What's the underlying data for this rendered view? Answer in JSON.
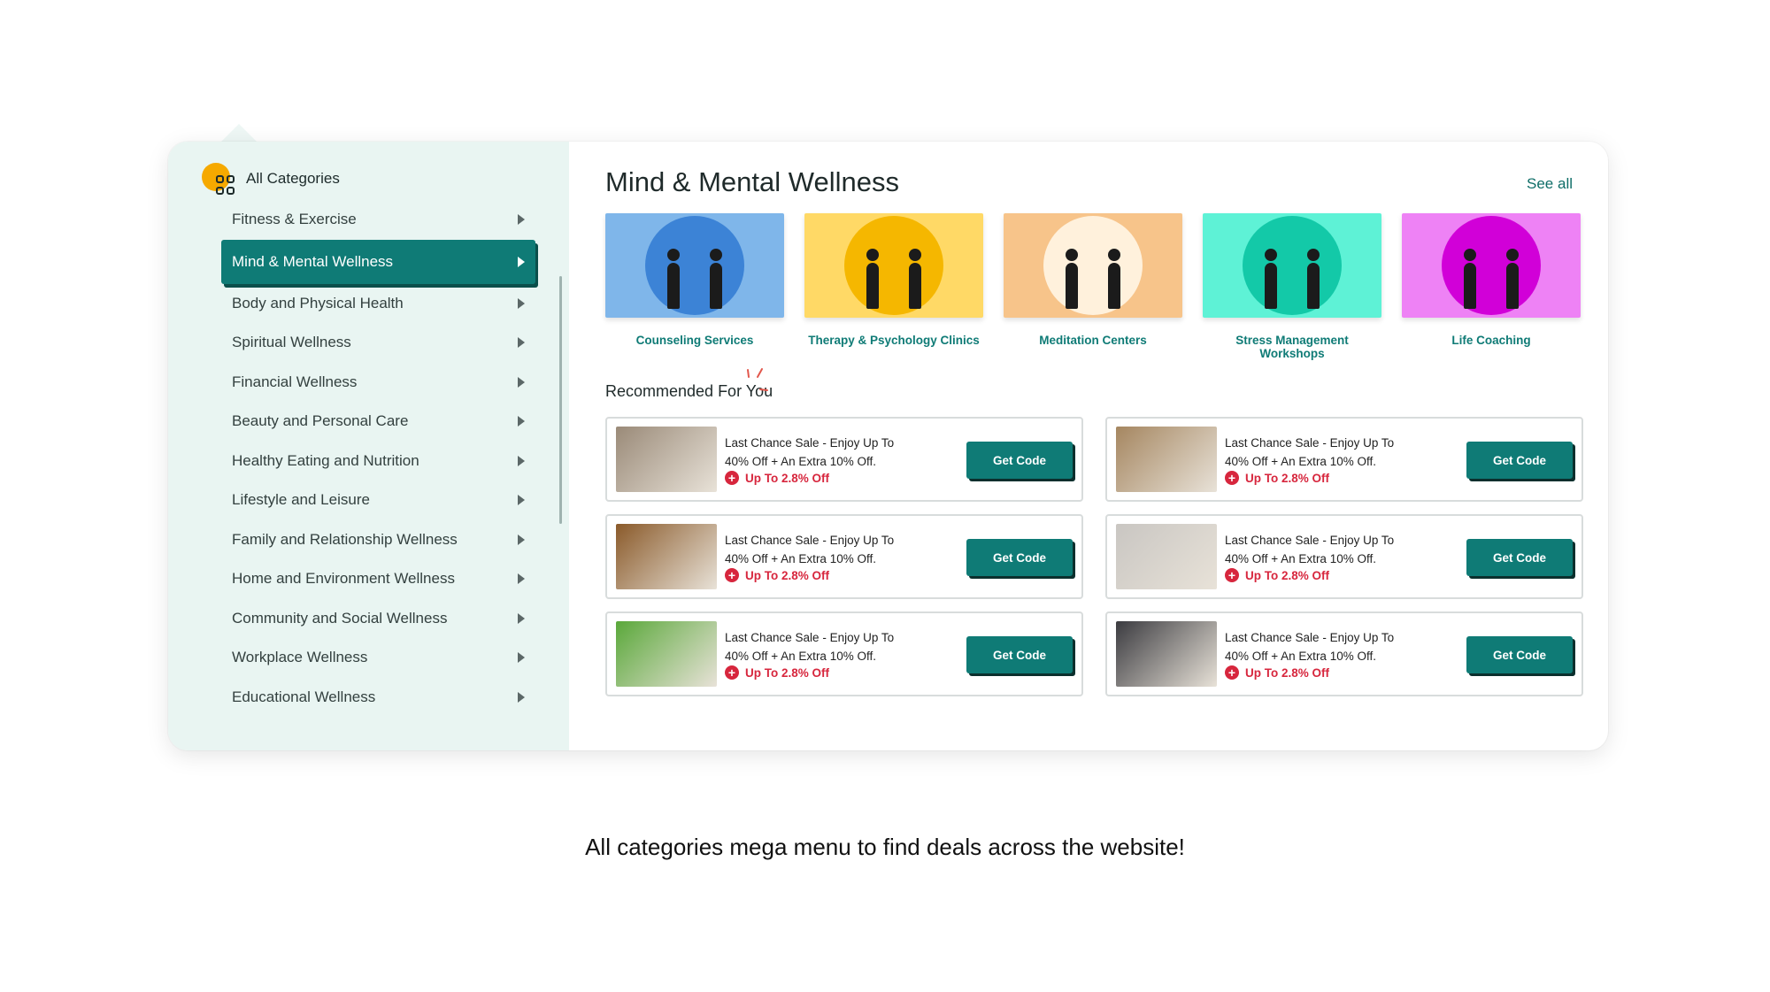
{
  "sidebar": {
    "all_categories_label": "All Categories",
    "items": [
      {
        "label": "Fitness & Exercise"
      },
      {
        "label": "Mind & Mental Wellness",
        "active": true
      },
      {
        "label": "Body and Physical Health"
      },
      {
        "label": "Spiritual Wellness"
      },
      {
        "label": "Financial Wellness"
      },
      {
        "label": "Beauty and Personal Care"
      },
      {
        "label": "Healthy Eating and Nutrition"
      },
      {
        "label": "Lifestyle and Leisure"
      },
      {
        "label": "Family and Relationship Wellness"
      },
      {
        "label": "Home and Environment Wellness"
      },
      {
        "label": "Community and Social Wellness"
      },
      {
        "label": "Workplace Wellness"
      },
      {
        "label": "Educational Wellness"
      }
    ]
  },
  "main": {
    "heading": "Mind & Mental Wellness",
    "see_all": "See all",
    "subcategories": [
      {
        "label": "Counseling Services",
        "bg": "#7fb6ea",
        "circle": "#3c83d6"
      },
      {
        "label": "Therapy & Psychology Clinics",
        "bg": "#ffd966",
        "circle": "#f5b700"
      },
      {
        "label": "Meditation Centers",
        "bg": "#f7c48a",
        "circle": "#fff1dc"
      },
      {
        "label": "Stress Management Workshops",
        "bg": "#5ef2d6",
        "circle": "#13c9a8"
      },
      {
        "label": "Life Coaching",
        "bg": "#ee82f5",
        "circle": "#d100d8"
      }
    ],
    "recommended_title": "Recommended For You",
    "deals": [
      {
        "title": "Last Chance Sale - Enjoy Up To 40% Off + An Extra 10% Off.",
        "off": "Up To 2.8% Off",
        "button": "Get Code",
        "img_color": "#9a8a78"
      },
      {
        "title": "Last Chance Sale - Enjoy Up To 40% Off + An Extra 10% Off.",
        "off": "Up To 2.8% Off",
        "button": "Get Code",
        "img_color": "#a58660"
      },
      {
        "title": "Last Chance Sale - Enjoy Up To 40% Off + An Extra 10% Off.",
        "off": "Up To 2.8% Off",
        "button": "Get Code",
        "img_color": "#8a5a2a"
      },
      {
        "title": "Last Chance Sale - Enjoy Up To 40% Off + An Extra 10% Off.",
        "off": "Up To 2.8% Off",
        "button": "Get Code",
        "img_color": "#c9c6c2"
      },
      {
        "title": "Last Chance Sale - Enjoy Up To 40% Off + An Extra 10% Off.",
        "off": "Up To 2.8% Off",
        "button": "Get Code",
        "img_color": "#5aa83a"
      },
      {
        "title": "Last Chance Sale - Enjoy Up To 40% Off + An Extra 10% Off.",
        "off": "Up To 2.8% Off",
        "button": "Get Code",
        "img_color": "#3b3b40"
      }
    ]
  },
  "caption": "All categories mega menu to find deals across the website!",
  "colors": {
    "accent": "#0f7b76",
    "sale_red": "#d7263d",
    "sidebar_bg": "#e9f5f2",
    "brand_orange": "#f6a900"
  }
}
